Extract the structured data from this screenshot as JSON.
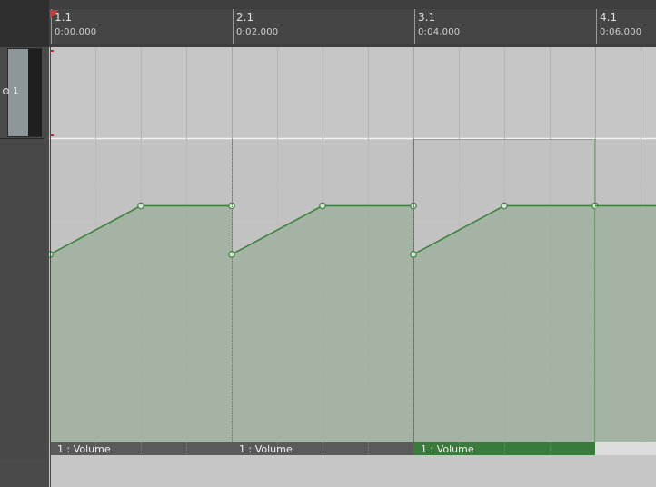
{
  "ruler": {
    "markers": [
      {
        "label": "1.1",
        "time": "0:00.000"
      },
      {
        "label": "2.1",
        "time": "0:02.000"
      },
      {
        "label": "3.1",
        "time": "0:04.000"
      },
      {
        "label": "4.1",
        "time": "0:06.000"
      }
    ]
  },
  "track": {
    "number": "1"
  },
  "envelope": {
    "name": "Volume",
    "color": "#3f8240",
    "fill_color": "#9fb09f",
    "item_bar_color": "#5a5a5a",
    "item_bar_selected_color": "#3a7a3c",
    "items": [
      {
        "label": "1 : Volume",
        "selected": false
      },
      {
        "label": "1 : Volume",
        "selected": false
      },
      {
        "label": "1 : Volume",
        "selected": true
      }
    ],
    "points_per_item": [
      {
        "beat": 0,
        "level": 0.62
      },
      {
        "beat": 2,
        "level": 0.78
      },
      {
        "beat": 4,
        "level": 0.78
      }
    ]
  }
}
